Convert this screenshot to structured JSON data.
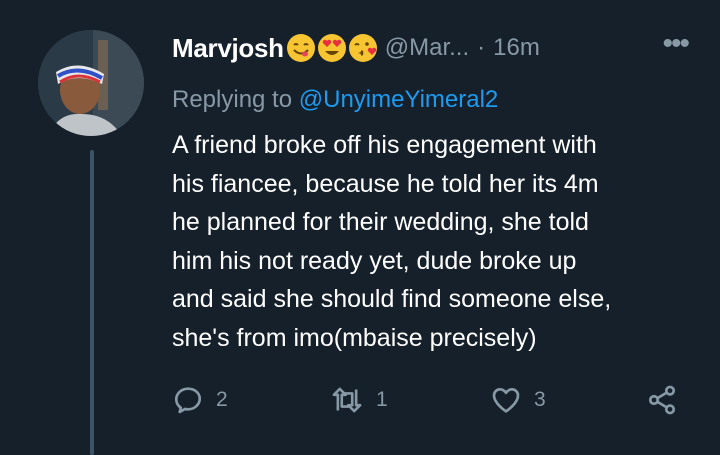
{
  "tweet": {
    "display_name": "Marvjosh",
    "emojis": [
      "face-savoring-food-emoji",
      "smiling-face-with-heart-eyes-emoji",
      "face-blowing-kiss-emoji"
    ],
    "handle": "@Mar...",
    "separator": "·",
    "time": "16m",
    "more_label": "•••",
    "replying_prefix": "Replying to ",
    "replying_to": "@UnyimeYimeral2",
    "body_lines": [
      "A friend broke off his engagement with",
      "his fiancee, because he told her its 4m",
      "he planned for their wedding, she told",
      "him his not ready yet, dude broke up",
      "and said she should find someone else,",
      "she's from imo(mbaise precisely)"
    ],
    "actions": {
      "reply_count": "2",
      "retweet_count": "1",
      "like_count": "3"
    }
  },
  "colors": {
    "background": "#15202b",
    "secondary_text": "#8899a6",
    "link": "#1d9bf0"
  },
  "icons": [
    "reply-icon",
    "retweet-icon",
    "like-icon",
    "share-icon",
    "more-icon"
  ]
}
